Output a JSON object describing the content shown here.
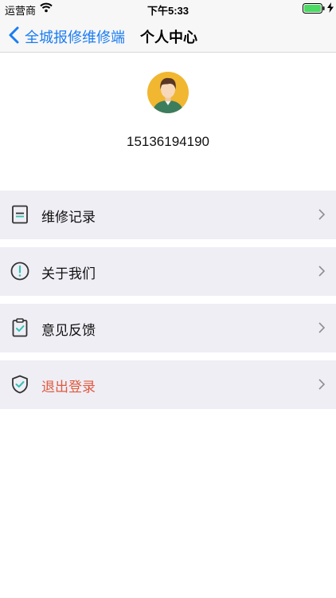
{
  "status_bar": {
    "carrier": "运营商",
    "time": "下午5:33"
  },
  "nav": {
    "back_label": "全城报修维修端",
    "title": "个人中心"
  },
  "profile": {
    "phone": "15136194190"
  },
  "menu": {
    "items": [
      {
        "label": "维修记录",
        "icon": "repair-record-icon"
      },
      {
        "label": "关于我们",
        "icon": "info-icon"
      },
      {
        "label": "意见反馈",
        "icon": "feedback-clipboard-icon"
      },
      {
        "label": "退出登录",
        "icon": "logout-shield-icon"
      }
    ]
  },
  "colors": {
    "accent": "#1a7cf2",
    "danger": "#e05a3e",
    "teal": "#34c1b3",
    "menu_bg": "#efeef5",
    "avatar_bg": "#f1b730"
  }
}
